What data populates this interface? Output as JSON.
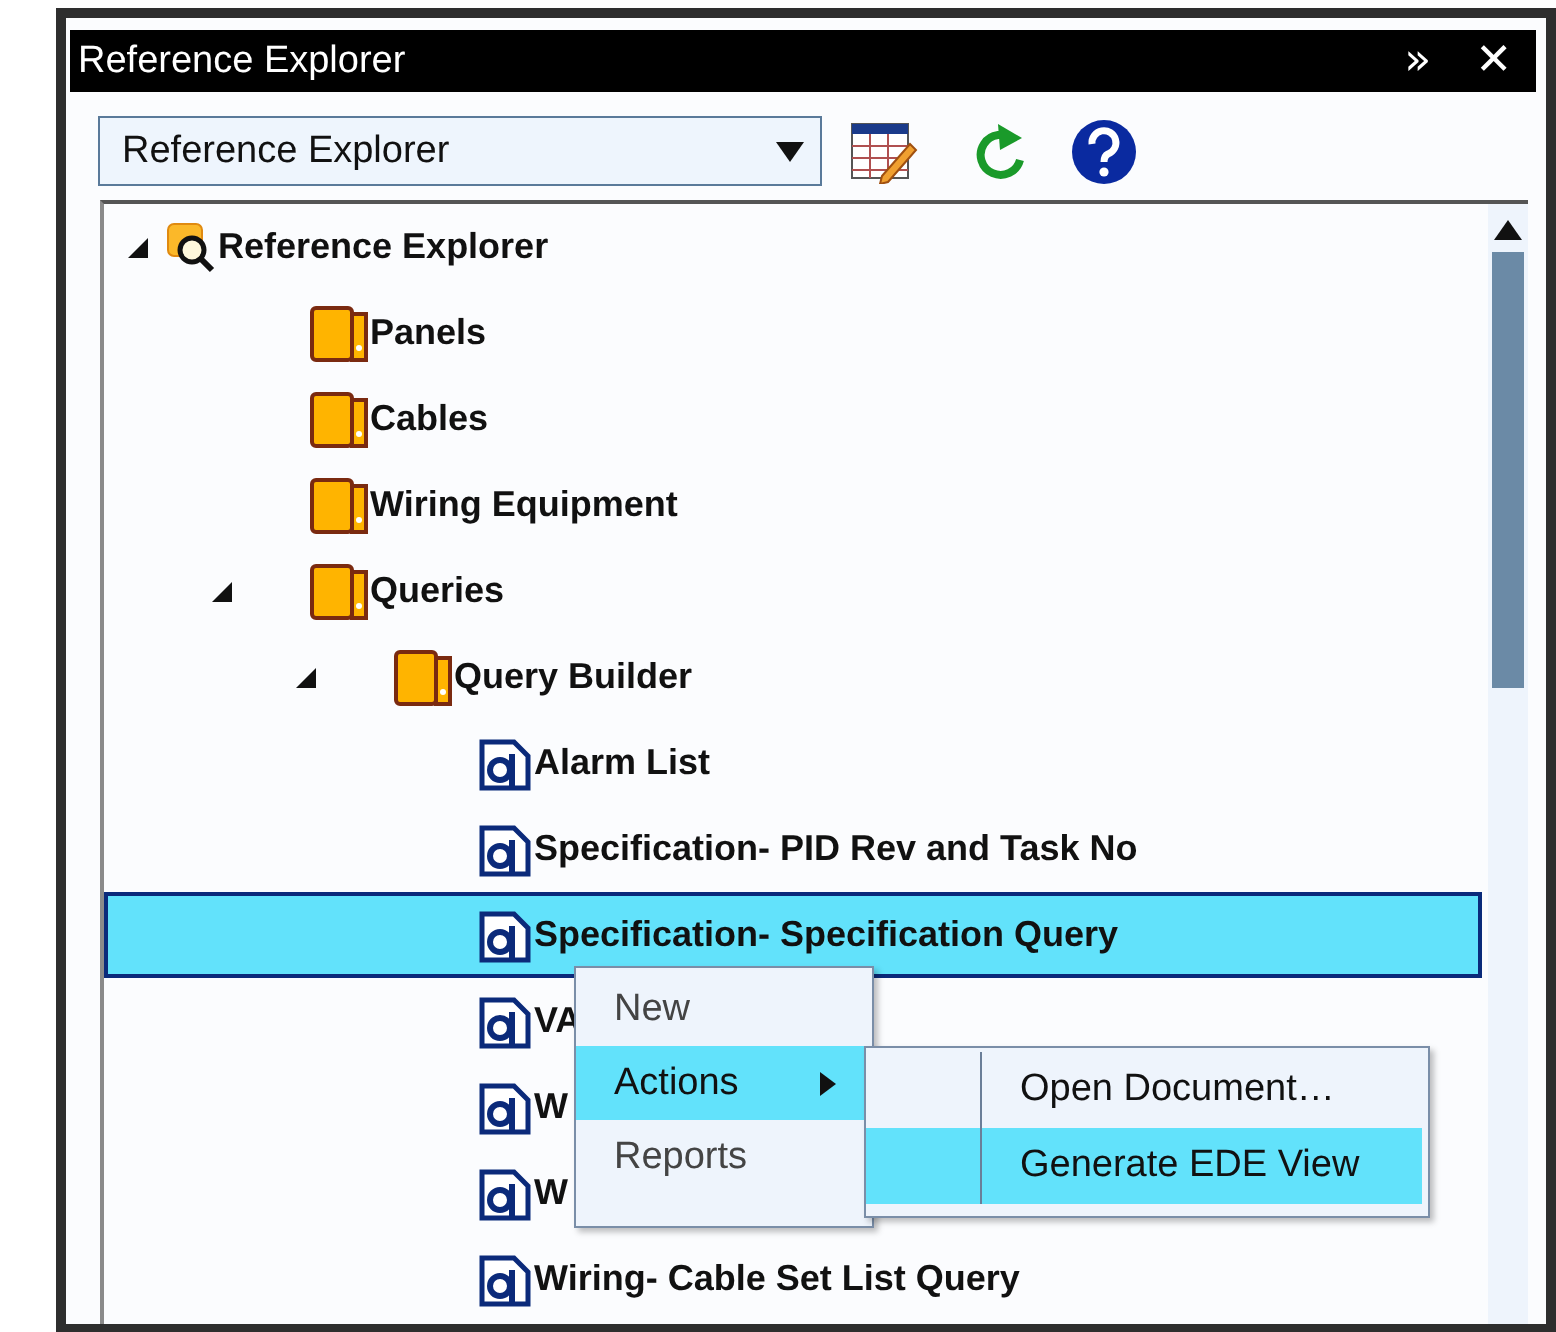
{
  "window": {
    "title": "Reference Explorer",
    "title_buttons": [
      "»",
      "✕"
    ]
  },
  "toolbar": {
    "view_select": {
      "value": "Reference Explorer"
    }
  },
  "tree": {
    "items": [
      {
        "label": "Reference Explorer",
        "kind": "root",
        "expanded": true,
        "selected": false,
        "children": [
          {
            "label": "Panels",
            "kind": "folder",
            "selected": false
          },
          {
            "label": "Cables",
            "kind": "folder",
            "selected": false
          },
          {
            "label": "Wiring Equipment",
            "kind": "folder",
            "selected": false
          },
          {
            "label": "Queries",
            "kind": "folder",
            "expanded": true,
            "selected": false,
            "children": [
              {
                "label": "Query Builder",
                "kind": "folder",
                "expanded": true,
                "selected": false,
                "children": [
                  {
                    "label": "Alarm List",
                    "kind": "document",
                    "selected": false
                  },
                  {
                    "label": "Specification- PID Rev and Task No",
                    "kind": "document",
                    "selected": false
                  },
                  {
                    "label": "Specification- Specification Query",
                    "kind": "document",
                    "selected": true
                  },
                  {
                    "label": "VA",
                    "kind": "document",
                    "selected": false
                  },
                  {
                    "label": "W",
                    "kind": "document",
                    "selected": false
                  },
                  {
                    "label": "W",
                    "kind": "document",
                    "selected": false
                  },
                  {
                    "label": "Wiring- Cable Set List Query",
                    "kind": "document",
                    "selected": false
                  }
                ]
              }
            ]
          }
        ]
      }
    ]
  },
  "context_menu": {
    "items": [
      {
        "label": "New",
        "selected": false,
        "submenu": false
      },
      {
        "label": "Actions",
        "selected": true,
        "submenu": true
      },
      {
        "label": "Reports",
        "selected": false,
        "submenu": false
      }
    ]
  },
  "submenu": {
    "items": [
      {
        "label": "Open Document…",
        "selected": false
      },
      {
        "label": "Generate EDE View",
        "selected": true
      }
    ]
  }
}
